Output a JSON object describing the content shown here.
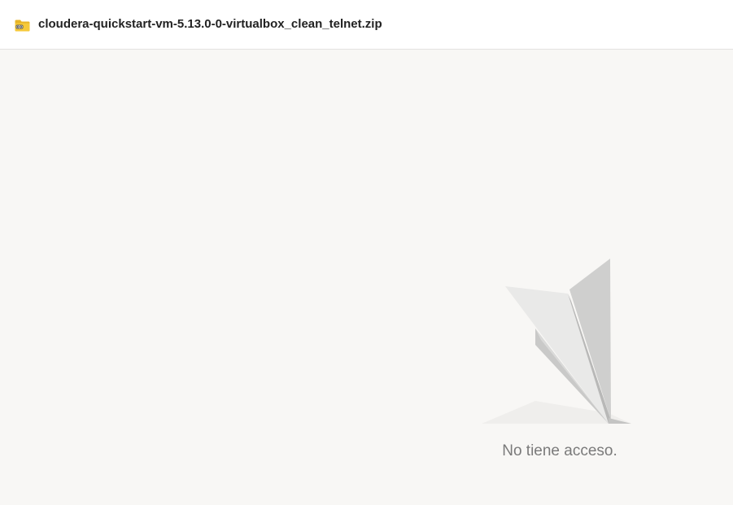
{
  "header": {
    "file_name": "cloudera-quickstart-vm-5.13.0-0-virtualbox_clean_telnet.zip",
    "file_icon": "zip-folder-icon"
  },
  "main": {
    "message": "No tiene acceso.",
    "illustration": "paper-plane-illustration"
  },
  "colors": {
    "folder": "#e8b526",
    "background": "#f8f7f5",
    "message_text": "#7a7a7a"
  }
}
